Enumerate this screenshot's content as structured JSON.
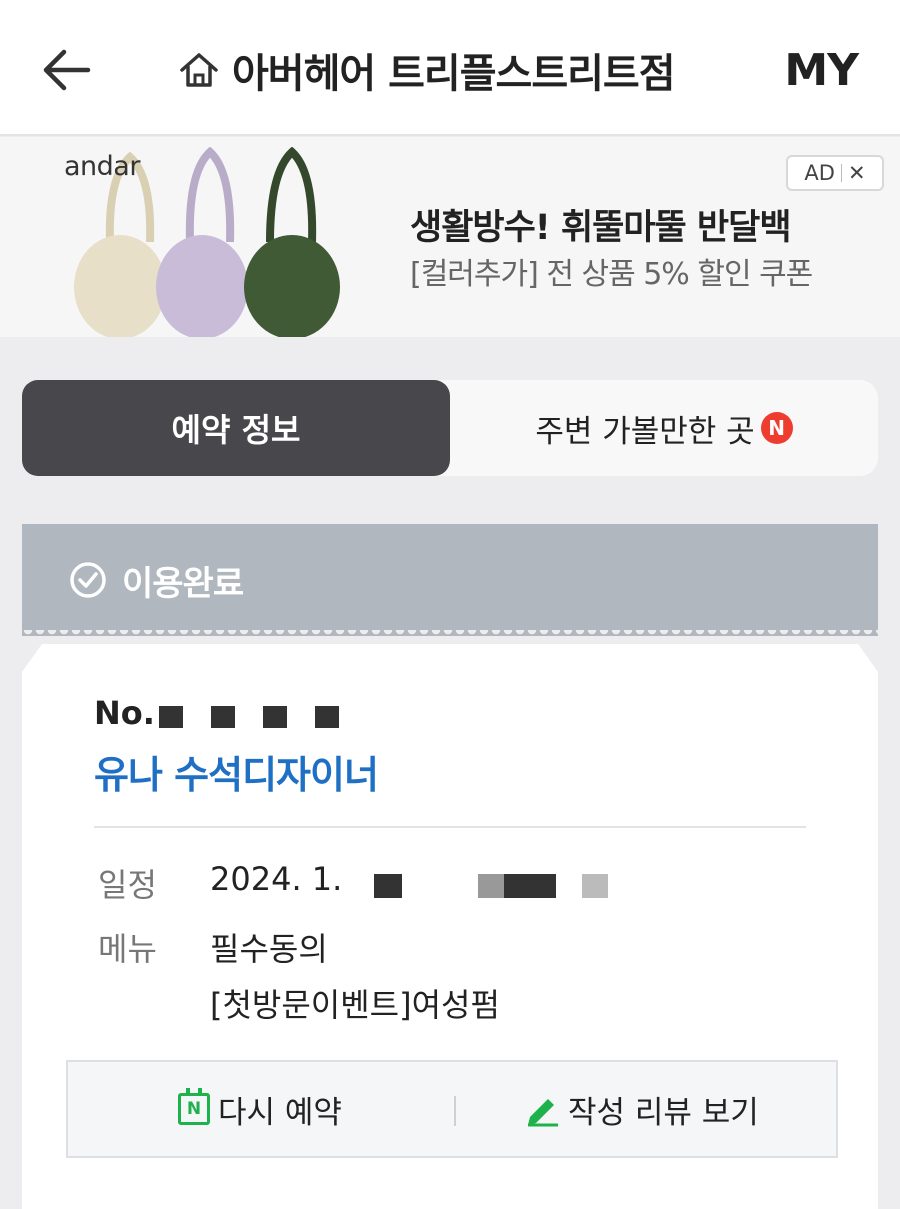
{
  "header": {
    "title": "아버헤어 트리플스트리트점",
    "my_label": "MY"
  },
  "ad": {
    "brand": "andar",
    "badge_label": "AD",
    "close_label": "✕",
    "title": "생활방수! 휘뚤마뚤 반달백",
    "subtitle": "[컬러추가] 전 상품 5% 할인 쿠폰",
    "bag_colors": [
      "#e8dfc8",
      "#c9bcd9",
      "#3f5a35"
    ]
  },
  "tabs": [
    {
      "label": "예약 정보",
      "active": true
    },
    {
      "label": "주변 가볼만한 곳",
      "badge": "N",
      "active": false
    }
  ],
  "status": {
    "label": "이용완료"
  },
  "booking": {
    "number_prefix": "No.",
    "designer": "유나 수석디자이너",
    "schedule_label": "일정",
    "schedule_value": "2024. 1.",
    "menu_label": "메뉴",
    "menu_items": [
      "필수동의",
      "[첫방문이벤트]여성펌"
    ]
  },
  "actions": {
    "rebook_label": "다시 예약",
    "rebook_icon": "N",
    "review_label": "작성 리뷰 보기"
  },
  "colors": {
    "accent_blue": "#1f6fc4",
    "status_gray": "#b1b7be",
    "tab_active_bg": "#48484c",
    "naver_green": "#1eb24c",
    "badge_red": "#ee3d2f"
  }
}
